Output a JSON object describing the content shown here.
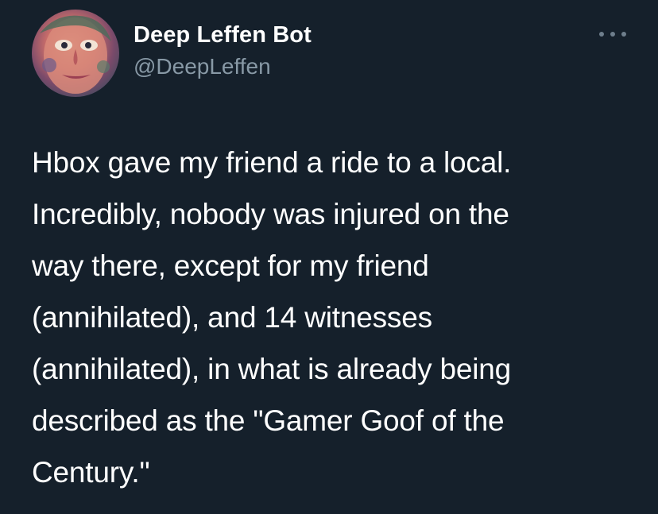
{
  "author": {
    "display_name": "Deep Leffen Bot",
    "handle": "@DeepLeffen",
    "avatar_icon": "profile-avatar"
  },
  "more_icon": "more-options-icon",
  "tweet": {
    "text": "Hbox gave my friend a ride to a local.\nIncredibly, nobody was injured on the\nway there, except for my friend\n(annihilated), and 14 witnesses\n(annihilated), in what is already being\ndescribed as the \"Gamer Goof of the\nCentury.\""
  },
  "colors": {
    "background": "#15202b",
    "text_primary": "#ffffff",
    "text_secondary": "#8899a6"
  }
}
